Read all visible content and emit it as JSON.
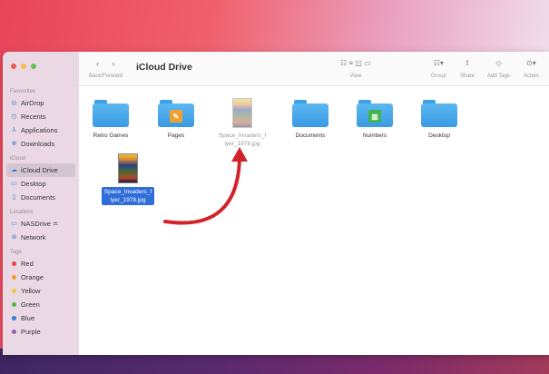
{
  "window": {
    "title": "iCloud Drive",
    "nav_label": "Back/Forward",
    "nav_arrows": "‹  ›"
  },
  "toolbar": {
    "view_label": "View",
    "group_label": "Group",
    "share_label": "Share",
    "add_tags_label": "Add Tags",
    "action_label": "Action"
  },
  "sidebar": {
    "favourites_heading": "Favourites",
    "favourites": [
      "AirDrop",
      "Recents",
      "Applications",
      "Downloads"
    ],
    "icloud_heading": "iCloud",
    "icloud": [
      "iCloud Drive",
      "Desktop",
      "Documents"
    ],
    "locations_heading": "Locations",
    "locations": [
      "NASDrive ≐",
      "Network"
    ],
    "tags_heading": "Tags",
    "tags": [
      {
        "label": "Red",
        "color": "#e8453c"
      },
      {
        "label": "Orange",
        "color": "#f29a2e"
      },
      {
        "label": "Yellow",
        "color": "#f4c542"
      },
      {
        "label": "Green",
        "color": "#4cb84c"
      },
      {
        "label": "Blue",
        "color": "#3a7bd5"
      },
      {
        "label": "Purple",
        "color": "#9b59b6"
      }
    ]
  },
  "files": [
    {
      "label": "Retro Games",
      "kind": "folder"
    },
    {
      "label": "Pages",
      "kind": "folder",
      "glyph_color": "#f0a030"
    },
    {
      "label_line1": "Space_Invaders_f",
      "label_line2": "lyer_1978.jpg",
      "kind": "image-ghost"
    },
    {
      "label": "Documents",
      "kind": "folder"
    },
    {
      "label": "Numbers",
      "kind": "folder",
      "glyph_color": "#3fb54a"
    },
    {
      "label": "Desktop",
      "kind": "folder"
    }
  ],
  "dragged_file": {
    "label_line1": "Space_Invaders_f",
    "label_line2": "lyer_1978.jpg"
  },
  "colors": {
    "selection": "#2f6ed9",
    "arrow": "#d3222a",
    "folder": "#4aa8ee"
  }
}
